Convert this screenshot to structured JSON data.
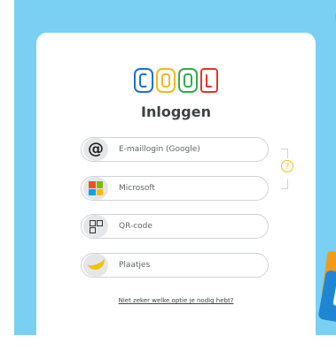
{
  "logo": {
    "letters": [
      "C",
      "O",
      "O",
      "L"
    ],
    "colors": [
      "#1e6fd9",
      "#f2b91a",
      "#2fae4a",
      "#e0382b"
    ]
  },
  "title": "Inloggen",
  "options": [
    {
      "label": "E-maillogin (Google)",
      "icon": "at-icon"
    },
    {
      "label": "Microsoft",
      "icon": "microsoft-icon"
    },
    {
      "label": "QR-code",
      "icon": "qr-code-icon"
    },
    {
      "label": "Plaatjes",
      "icon": "banana-icon"
    }
  ],
  "help": {
    "glyph": "?"
  },
  "help_link": "Niet zeker welke optie je nodig hebt?",
  "colors": {
    "background": "#79d0f2",
    "card": "#ffffff",
    "accent": "#f2b91a"
  }
}
